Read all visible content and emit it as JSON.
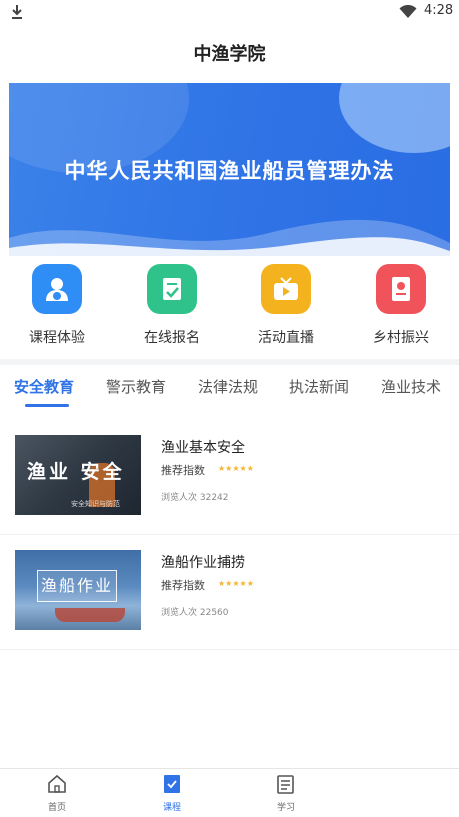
{
  "status_bar": {
    "time": "4:28",
    "icons": [
      "download-icon",
      "wifi-icon"
    ]
  },
  "app": {
    "title": "中渔学院"
  },
  "banner": {
    "headline": "中华人民共和国渔业船员管理办法"
  },
  "quick_links": [
    {
      "label": "课程体验",
      "icon": "course-trial-icon",
      "color": "#2f8ef5"
    },
    {
      "label": "在线报名",
      "icon": "online-signup-icon",
      "color": "#2fc38b"
    },
    {
      "label": "活动直播",
      "icon": "live-broadcast-icon",
      "color": "#f5b21f"
    },
    {
      "label": "乡村振兴",
      "icon": "rural-revitalization-icon",
      "color": "#f0545a"
    }
  ],
  "tabs": [
    "安全教育",
    "警示教育",
    "法律法规",
    "执法新闻",
    "渔业技术"
  ],
  "active_tab": "安全教育",
  "courses": [
    {
      "title": "渔业基本安全",
      "rating_label": "推荐指数",
      "stars": "★★★★★",
      "views": "浏览人次 32242",
      "thumb_text": "渔业 安全",
      "thumb_sub": "安全知识与防范"
    },
    {
      "title": "渔船作业捕捞",
      "rating_label": "推荐指数",
      "stars": "★★★★★",
      "views": "浏览人次 22560",
      "thumb_text": "渔船作业"
    }
  ],
  "bottom_nav": [
    {
      "label": "首页",
      "icon": "home-icon"
    },
    {
      "label": "课程",
      "icon": "course-icon",
      "active": true
    },
    {
      "label": "学习",
      "icon": "study-icon"
    }
  ],
  "colors": {
    "accent": "#2f73e6",
    "star": "#f2b632"
  }
}
